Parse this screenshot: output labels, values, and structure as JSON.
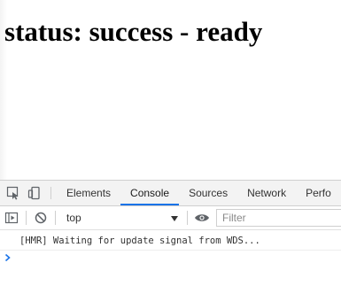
{
  "page": {
    "heading": "status: success - ready"
  },
  "devtools": {
    "toolbar_icons": [
      "inspect-element-icon",
      "device-toolbar-icon"
    ],
    "tabs": [
      {
        "label": "Elements",
        "active": false
      },
      {
        "label": "Console",
        "active": true
      },
      {
        "label": "Sources",
        "active": false
      },
      {
        "label": "Network",
        "active": false
      },
      {
        "label": "Perfo",
        "active": false
      }
    ],
    "console_toolbar": {
      "icons": [
        "show-sidebar-icon",
        "clear-console-icon",
        "eye-icon"
      ],
      "context": "top",
      "filter_placeholder": "Filter"
    },
    "messages": [
      "[HMR] Waiting for update signal from WDS..."
    ],
    "prompt_symbol": "›",
    "accent_color": "#1a73e8"
  }
}
